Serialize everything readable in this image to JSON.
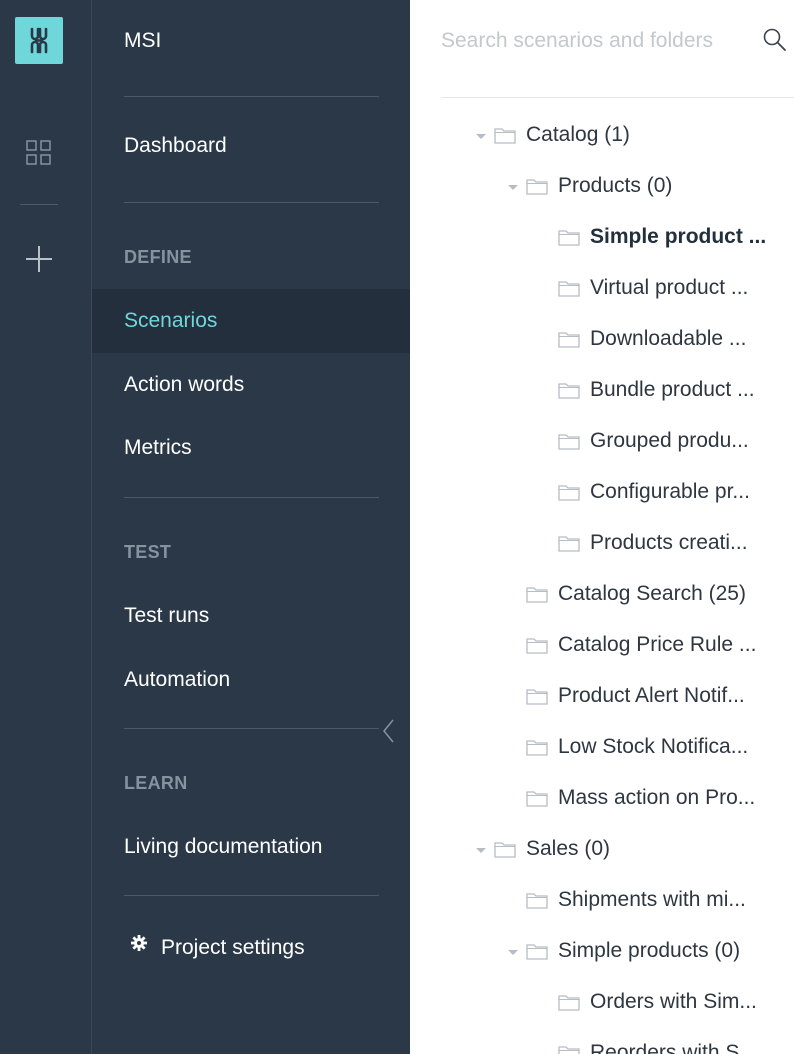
{
  "app": {
    "name": "MSI",
    "accent": "#6fd6d9",
    "sidebar_bg": "#2a3848"
  },
  "rail": {
    "logo_icon": "logo-icon",
    "dashboard_grid_icon": "grid-icon",
    "add_icon": "plus-icon"
  },
  "sidebar": {
    "project_name": "MSI",
    "dashboard": "Dashboard",
    "sections": {
      "define": "DEFINE",
      "test": "TEST",
      "learn": "LEARN"
    },
    "items": {
      "scenarios": "Scenarios",
      "action_words": "Action words",
      "metrics": "Metrics",
      "test_runs": "Test runs",
      "automation": "Automation",
      "living_documentation": "Living documentation",
      "project_settings": "Project settings"
    }
  },
  "search": {
    "placeholder": "Search scenarios and folders",
    "value": ""
  },
  "tree": [
    {
      "label": "Catalog (1)",
      "expanded": true,
      "bold": false
    },
    {
      "label": "Products (0)",
      "expanded": true,
      "bold": false
    },
    {
      "label": "Simple product ...",
      "bold": true
    },
    {
      "label": "Virtual product ...",
      "bold": false
    },
    {
      "label": "Downloadable ...",
      "bold": false
    },
    {
      "label": "Bundle product ...",
      "bold": false
    },
    {
      "label": "Grouped produ...",
      "bold": false
    },
    {
      "label": "Configurable pr...",
      "bold": false
    },
    {
      "label": "Products creati...",
      "bold": false
    },
    {
      "label": "Catalog Search (25)",
      "bold": false
    },
    {
      "label": "Catalog Price Rule ...",
      "bold": false
    },
    {
      "label": "Product Alert Notif...",
      "bold": false
    },
    {
      "label": "Low Stock Notifica...",
      "bold": false
    },
    {
      "label": "Mass action on Pro...",
      "bold": false
    },
    {
      "label": "Sales (0)",
      "expanded": true,
      "bold": false
    },
    {
      "label": "Shipments with mi...",
      "bold": false
    },
    {
      "label": "Simple products (0)",
      "expanded": true,
      "bold": false
    },
    {
      "label": "Orders with Sim...",
      "bold": false
    },
    {
      "label": "Reorders with S...",
      "bold": false
    }
  ]
}
